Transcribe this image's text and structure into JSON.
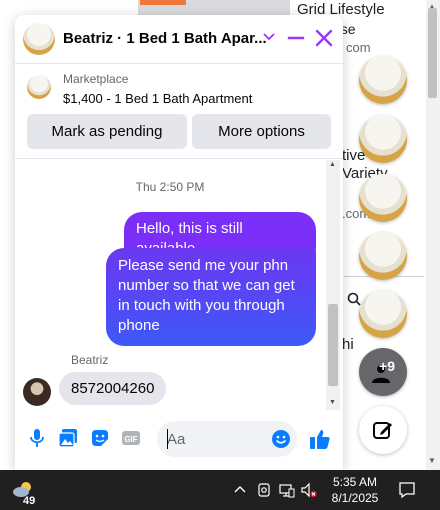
{
  "background": {
    "lines": [
      "Grid Lifestyle",
      "ase",
      "com",
      "tive-",
      "Variety",
      ".com",
      "hi"
    ]
  },
  "chat": {
    "title": "Beatriz · 1 Bed 1 Bath Apar...",
    "listing": {
      "source": "Marketplace",
      "description": "$1,400 - 1 Bed 1 Bath Apartment",
      "buttons": [
        "Mark as pending",
        "More options"
      ]
    },
    "timestamp": "Thu 2:50 PM",
    "messages_out": [
      "Hello, this is still available",
      "Please send me your phn number so that we can get in touch with you through phone"
    ],
    "sender_name": "Beatriz",
    "message_in": "8572004260",
    "composer": {
      "placeholder": "Aa"
    }
  },
  "chatheads": {
    "more_count": "+9"
  },
  "taskbar": {
    "weather_temp": "49",
    "time": "5:35 AM",
    "date": "8/1/2025"
  },
  "colors": {
    "accent": "#a033ff",
    "bubble_purple": "#7a2ef7",
    "bubble_blue": "#3e58f7",
    "icon_blue": "#0a7cff"
  }
}
